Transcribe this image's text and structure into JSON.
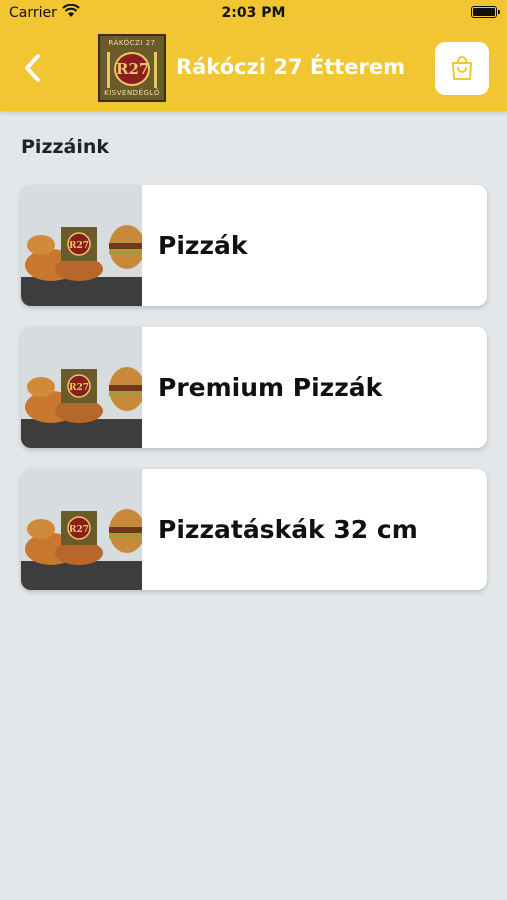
{
  "status": {
    "carrier": "Carrier",
    "time": "2:03 PM"
  },
  "header": {
    "title": "Rákóczi 27 Étterem",
    "logo_top": "RÁKÓCZI 27",
    "logo_mark": "R27",
    "logo_bottom": "KISVENDÉGLŐ"
  },
  "section": {
    "title": "Pizzáink"
  },
  "categories": [
    {
      "label": "Pizzák"
    },
    {
      "label": "Premium Pizzák"
    },
    {
      "label": "Pizzatáskák 32 cm"
    }
  ],
  "colors": {
    "brand": "#f2c533",
    "background": "#e3e7e9"
  }
}
